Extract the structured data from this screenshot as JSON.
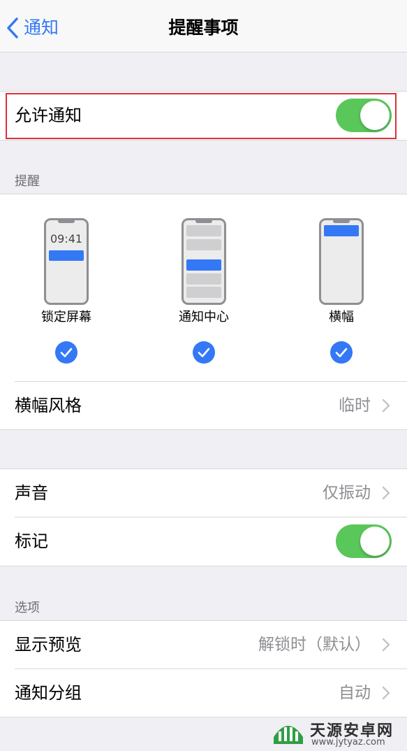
{
  "nav": {
    "back_label": "通知",
    "title": "提醒事项"
  },
  "allow": {
    "label": "允许通知",
    "on": true
  },
  "alerts": {
    "header": "提醒",
    "styles": [
      {
        "caption": "锁定屏幕",
        "checked": true,
        "time": "09:41"
      },
      {
        "caption": "通知中心",
        "checked": true
      },
      {
        "caption": "横幅",
        "checked": true
      }
    ],
    "banner_style": {
      "label": "横幅风格",
      "value": "临时"
    }
  },
  "sound_badge": {
    "sound": {
      "label": "声音",
      "value": "仅振动"
    },
    "badge": {
      "label": "标记",
      "on": true
    }
  },
  "options": {
    "header": "选项",
    "show_previews": {
      "label": "显示预览",
      "value": "解锁时（默认）"
    },
    "grouping": {
      "label": "通知分组",
      "value": "自动"
    }
  },
  "watermark": {
    "name": "天源安卓网",
    "url": "www.jytyaz.com"
  },
  "colors": {
    "accent": "#3478f6",
    "toggle_on": "#5ac75b",
    "highlight": "#d9313a",
    "background": "#efeff4"
  }
}
